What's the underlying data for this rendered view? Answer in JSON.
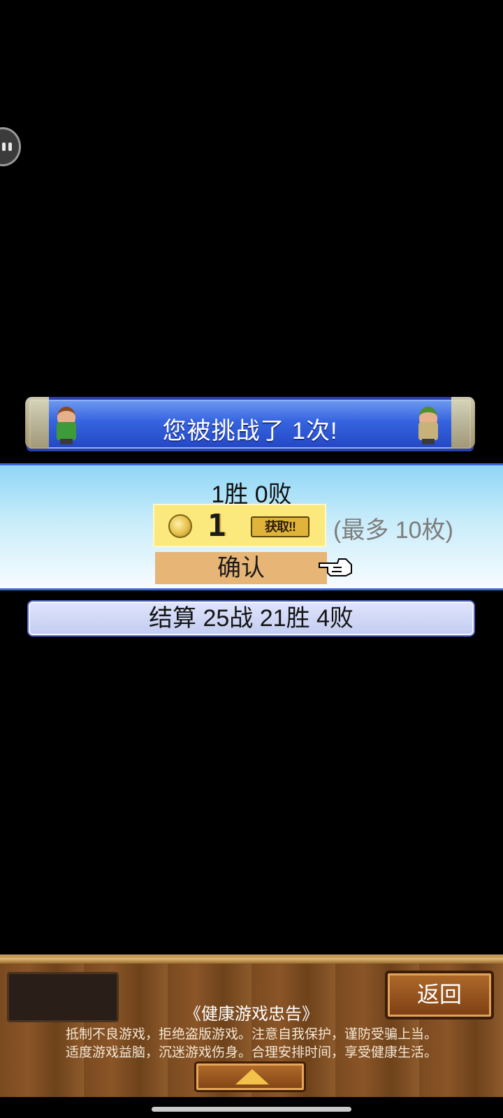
{
  "banner": {
    "text": "您被挑战了 1次!"
  },
  "result": {
    "record": "1胜 0败",
    "reward_count": "1",
    "reward_badge": "获取!!",
    "max_note": "(最多 10枚)",
    "confirm_label": "确认"
  },
  "summary": {
    "text": "结算 25战 21胜 4败"
  },
  "footer": {
    "back_label": "返回",
    "notice_title": "《健康游戏忠告》",
    "notice_line1": "抵制不良游戏，拒绝盗版游戏。注意自我保护，谨防受骗上当。",
    "notice_line2": "适度游戏益脑，沉迷游戏伤身。合理安排时间，享受健康生活。"
  },
  "icons": {
    "floating_assistant": "assistant-bubble-icon",
    "coin": "coin-icon",
    "pointer": "pointing-hand-icon",
    "up_arrow": "up-arrow-icon",
    "left_avatar": "challenger-avatar-icon",
    "right_avatar": "player-avatar-icon"
  },
  "colors": {
    "banner_blue": "#3563df",
    "panel_sky": "#8fd6f6",
    "reward_yellow": "#fbe97e",
    "confirm_orange": "#e7b575",
    "wood_brown": "#7a4a20"
  }
}
